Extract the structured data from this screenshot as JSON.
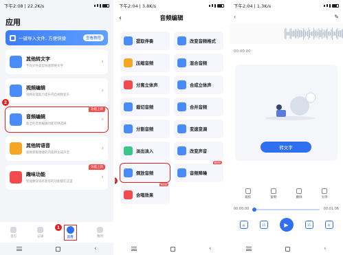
{
  "colors": {
    "accent": "#2f6ff0",
    "highlight": "#e02020",
    "tag": "#f24b4b"
  },
  "screen1": {
    "status_left": "下午2:08 | 22.2K/s",
    "title": "应用",
    "banner": {
      "text": "一键导入文件, 方便快捷",
      "button": "查看教程"
    },
    "cards": [
      {
        "title": "其他转文字",
        "subtitle": "不同文件类型快速转换文字",
        "icon": "document-text-icon",
        "color": "#4a8cf7"
      },
      {
        "title": "视频编辑",
        "subtitle": "视频处理能力提升开启视频变声",
        "icon": "video-icon",
        "color": "#4a8cf7"
      },
      {
        "title": "音频编辑",
        "subtitle": "超全的音频编辑功能可供选择",
        "icon": "audio-wave-icon",
        "color": "#4a8cf7",
        "tag": "功能上新"
      },
      {
        "title": "其他转语音",
        "subtitle": "极致获取便捷的内容转化成声音",
        "icon": "speech-icon",
        "color": "#f5a623"
      },
      {
        "title": "趣味功能",
        "subtitle": "智能朗读等有意思的功能都在这里",
        "icon": "fun-icon",
        "color": "#f24b4b",
        "tag": "功能上新"
      }
    ],
    "tabs": [
      "首页",
      "记录",
      "应用",
      "我的"
    ],
    "markers": [
      "1",
      "2"
    ]
  },
  "screen2": {
    "status_left": "下午2:04 | 3.8K/s",
    "title": "音频编辑",
    "items": [
      {
        "label": "提取伴奏",
        "icon": "extract-icon",
        "color": "#4a8cf7"
      },
      {
        "label": "改变音频格式",
        "icon": "format-icon",
        "color": "#4a8cf7"
      },
      {
        "label": "压缩音频",
        "icon": "compress-icon",
        "color": "#f5a623"
      },
      {
        "label": "混合音频",
        "icon": "mix-icon",
        "color": "#4a8cf7"
      },
      {
        "label": "分离立体声",
        "icon": "split-stereo-icon",
        "color": "#f24b4b"
      },
      {
        "label": "合成立体声",
        "icon": "merge-stereo-icon",
        "color": "#4a8cf7"
      },
      {
        "label": "裁切音频",
        "icon": "cut-icon",
        "color": "#4a8cf7"
      },
      {
        "label": "合并音频",
        "icon": "merge-icon",
        "color": "#4a8cf7"
      },
      {
        "label": "分割音频",
        "icon": "divide-icon",
        "color": "#4a8cf7"
      },
      {
        "label": "变速变调",
        "icon": "speed-icon",
        "color": "#4a8cf7"
      },
      {
        "label": "淡出淡入",
        "icon": "fade-icon",
        "color": "#3cc48a"
      },
      {
        "label": "改变声音",
        "icon": "voice-change-icon",
        "color": "#4a8cf7"
      },
      {
        "label": "倒放音频",
        "icon": "reverse-icon",
        "color": "#4a8cf7"
      },
      {
        "label": "音频降噪",
        "icon": "denoise-icon",
        "color": "#4a8cf7",
        "tag": "NEW"
      },
      {
        "label": "合唱效果",
        "icon": "chorus-icon",
        "color": "#f24b4b",
        "tag": "NEW"
      }
    ],
    "marker": "3"
  },
  "screen3": {
    "status_left": "下午2:04 | 1.3K/s",
    "wave_time": "00:00.00",
    "convert_button": "转文字",
    "tools": [
      "裁剪",
      "复制",
      "删除",
      "分享"
    ],
    "time_start": "00:00.00",
    "time_end": "00:01.06",
    "progress": 0.0
  }
}
